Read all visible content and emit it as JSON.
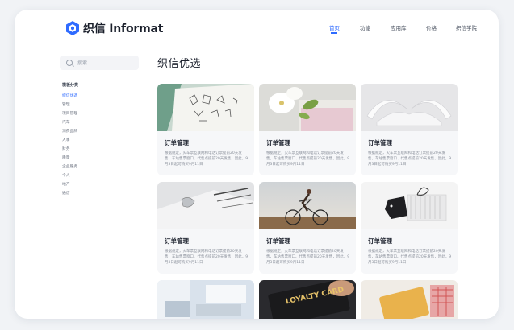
{
  "brand": {
    "logo_text": "织信 Informat",
    "accent": "#2f6bff"
  },
  "nav": [
    {
      "label": "首页",
      "active": true
    },
    {
      "label": "功能",
      "active": false
    },
    {
      "label": "应用库",
      "active": false
    },
    {
      "label": "价格",
      "active": false
    },
    {
      "label": "织信学院",
      "active": false
    }
  ],
  "sidebar": {
    "search_placeholder": "搜索",
    "title": "模板分类",
    "items": [
      "织信优选",
      "管理",
      "项目管理",
      "汽车",
      "消费品牌",
      "人事",
      "财务",
      "质量",
      "企业服务",
      "个人",
      "地产",
      "通信"
    ]
  },
  "main": {
    "title": "织信优选",
    "cards": [
      {
        "title": "订单管理",
        "desc": "根据规定，火车票互联网和电话订票提前20天发售，车站售票窗口、代售点提前20天发售，因此，9月3日起可购买9月11日"
      },
      {
        "title": "订单管理",
        "desc": "根据规定，火车票互联网和电话订票提前20天发售，车站售票窗口、代售点提前20天发售，因此，9月3日起可购买9月11日"
      },
      {
        "title": "订单管理",
        "desc": "根据规定，火车票互联网和电话订票提前20天发售，车站售票窗口、代售点提前20天发售，因此，9月3日起可购买9月11日"
      },
      {
        "title": "订单管理",
        "desc": "根据规定，火车票互联网和电话订票提前20天发售，车站售票窗口、代售点提前20天发售，因此，9月3日起可购买9月11日"
      },
      {
        "title": "订单管理",
        "desc": "根据规定，火车票互联网和电话订票提前20天发售，车站售票窗口、代售点提前20天发售，因此，9月3日起可购买9月11日"
      },
      {
        "title": "订单管理",
        "desc": "根据规定，火车票互联网和电话订票提前20天发售，车站售票窗口、代售点提前20天发售，因此，9月3日起可购买9月11日"
      },
      {
        "title": "",
        "desc": ""
      },
      {
        "title": "",
        "desc": ""
      },
      {
        "title": "",
        "desc": ""
      }
    ],
    "loyalty_card_text": "LOYALTY CARD"
  }
}
